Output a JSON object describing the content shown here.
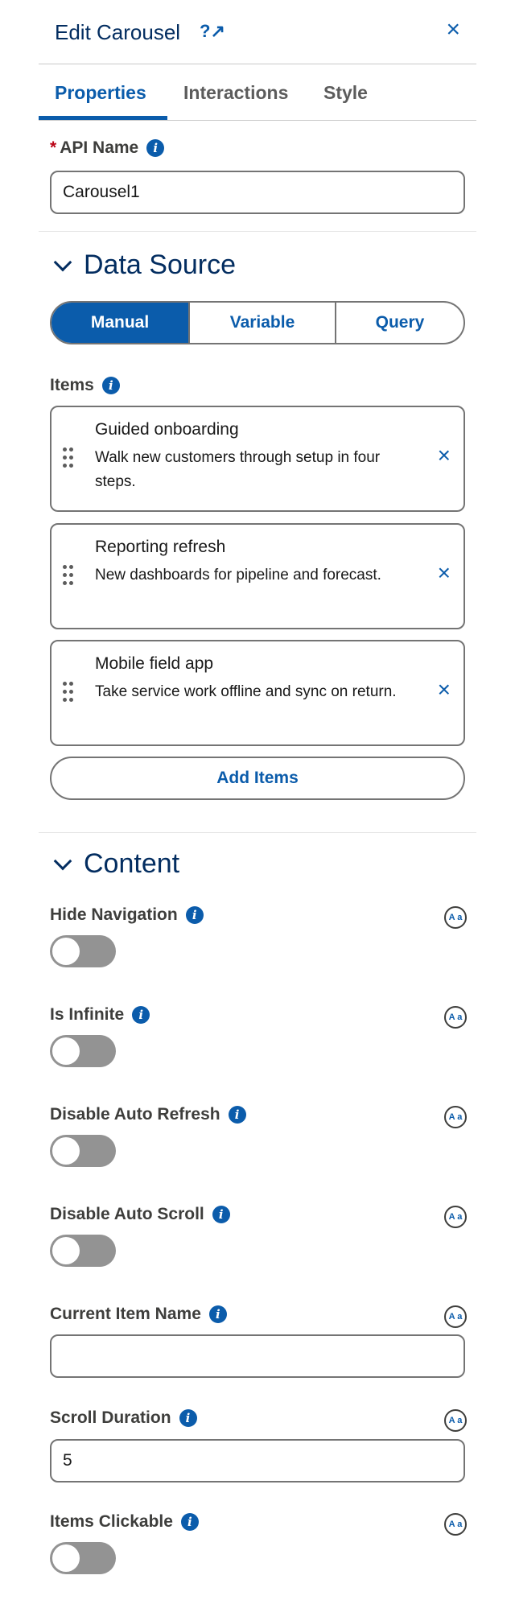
{
  "header": {
    "title": "Edit Carousel",
    "help_glyph": "?↗",
    "close_glyph": "×"
  },
  "tabs": [
    {
      "label": "Properties",
      "active": true
    },
    {
      "label": "Interactions",
      "active": false
    },
    {
      "label": "Style",
      "active": false
    }
  ],
  "api_name": {
    "required_mark": "*",
    "label": "API Name",
    "value": "Carousel1"
  },
  "data_source": {
    "title": "Data Source",
    "options": [
      {
        "label": "Manual",
        "selected": true
      },
      {
        "label": "Variable",
        "selected": false
      },
      {
        "label": "Query",
        "selected": false
      }
    ],
    "items_label": "Items",
    "items": [
      {
        "title": "Guided onboarding",
        "description": "Walk new customers through setup in four steps."
      },
      {
        "title": "Reporting refresh",
        "description": "New dashboards for pipeline and forecast."
      },
      {
        "title": "Mobile field app",
        "description": "Take service work offline and sync on return."
      }
    ],
    "add_button": "Add Items",
    "remove_glyph": "×"
  },
  "content": {
    "title": "Content",
    "hide_navigation": {
      "label": "Hide Navigation",
      "on": false
    },
    "is_infinite": {
      "label": "Is Infinite",
      "on": false
    },
    "disable_auto_refresh": {
      "label": "Disable Auto Refresh",
      "on": false
    },
    "disable_auto_scroll": {
      "label": "Disable Auto Scroll",
      "on": false
    },
    "current_item_name": {
      "label": "Current Item Name",
      "value": ""
    },
    "scroll_duration": {
      "label": "Scroll Duration",
      "value": "5"
    },
    "items_clickable": {
      "label": "Items Clickable",
      "on": false
    }
  },
  "info_glyph": "i",
  "resource_glyph": "A a",
  "colors": {
    "brand": "#0b5cab",
    "title": "#032d60",
    "required": "#ba0517",
    "toggle_off": "#939393"
  }
}
